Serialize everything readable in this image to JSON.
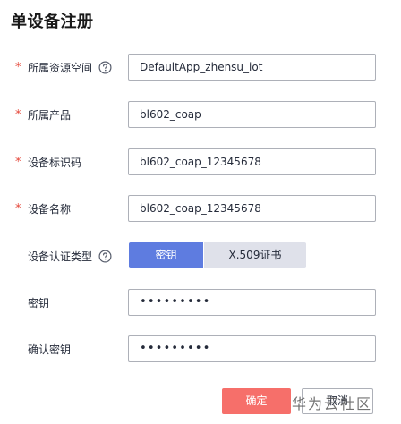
{
  "page": {
    "title": "单设备注册"
  },
  "form": {
    "required_mark": "*",
    "space": {
      "label": "所属资源空间",
      "value": "DefaultApp_zhensu_iot"
    },
    "product": {
      "label": "所属产品",
      "value": "bl602_coap"
    },
    "device_id": {
      "label": "设备标识码",
      "value": "bl602_coap_12345678"
    },
    "device_name": {
      "label": "设备名称",
      "value": "bl602_coap_12345678"
    },
    "auth_type": {
      "label": "设备认证类型",
      "options": [
        "密钥",
        "X.509证书"
      ],
      "selected": "密钥"
    },
    "secret": {
      "label": "密钥",
      "value": "•••••••••"
    },
    "confirm_secret": {
      "label": "确认密钥",
      "value": "•••••••••"
    }
  },
  "buttons": {
    "confirm": "确定",
    "cancel": "取消"
  },
  "watermark": "华为云社区",
  "colors": {
    "accent": "#5e7ce0",
    "danger_button": "#f66f6a",
    "required": "#e5483b"
  },
  "icons": {
    "help": "question-circle-icon"
  }
}
